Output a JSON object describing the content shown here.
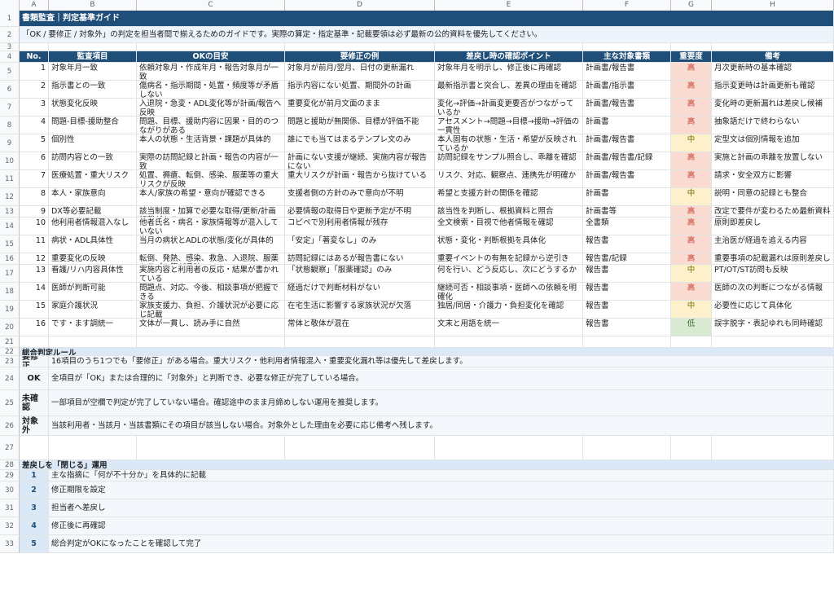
{
  "columns": [
    "A",
    "B",
    "C",
    "D",
    "E",
    "F",
    "G",
    "H"
  ],
  "title": "書類監査｜判定基準ガイド",
  "intro": "「OK / 要修正 / 対象外」の判定を担当者間で揃えるためのガイドです。実際の算定・指定基準・記載要領は必ず最新の公的資料を優先してください。",
  "headers": [
    "No.",
    "監査項目",
    "OKの目安",
    "要修正の例",
    "差戻し時の確認ポイント",
    "主な対象書類",
    "重要度",
    "備考"
  ],
  "items": [
    {
      "no": "1",
      "item": "対象年月一致",
      "ok": "依頼対象月・作成年月・報告対象月が一致",
      "fix": "対象月が前月/翌月、日付の更新漏れ",
      "check": "対象年月を明示し、修正後に再確認",
      "docs": "計画書/報告書",
      "pri": "高",
      "note": "月次更新時の基本確認"
    },
    {
      "no": "2",
      "item": "指示書との一致",
      "ok": "傷病名・指示期間・処置・頻度等が矛盾しない",
      "fix": "指示内容にない処置、期間外の計画",
      "check": "最新指示書と突合し、差異の理由を確認",
      "docs": "計画書/指示書",
      "pri": "高",
      "note": "指示変更時は計画更新も確認"
    },
    {
      "no": "3",
      "item": "状態変化反映",
      "ok": "入退院・急変・ADL変化等が計画/報告へ反映",
      "fix": "重要変化が前月文面のまま",
      "check": "変化→評価→計画変更要否がつながっているか",
      "docs": "計画書/報告書",
      "pri": "高",
      "note": "変化時の更新漏れは差戻し候補"
    },
    {
      "no": "4",
      "item": "問題-目標-援助整合",
      "ok": "問題、目標、援助内容に因果・目的のつながりがある",
      "fix": "問題と援助が無関係、目標が評価不能",
      "check": "アセスメント→問題→目標→援助→評価の一貫性",
      "docs": "計画書",
      "pri": "高",
      "note": "抽象語だけで終わらない"
    },
    {
      "no": "5",
      "item": "個別性",
      "ok": "本人の状態・生活背景・課題が具体的",
      "fix": "誰にでも当てはまるテンプレ文のみ",
      "check": "本人固有の状態・生活・希望が反映されているか",
      "docs": "計画書/報告書",
      "pri": "中",
      "note": "定型文は個別情報を追加"
    },
    {
      "no": "6",
      "item": "訪問内容との一致",
      "ok": "実際の訪問記録と計画・報告の内容が一致",
      "fix": "計画にない支援が継続、実施内容が報告にない",
      "check": "訪問記録をサンプル照合し、乖離を確認",
      "docs": "計画書/報告書/記録",
      "pri": "高",
      "note": "実施と計画の乖離を放置しない"
    },
    {
      "no": "7",
      "item": "医療処置・重大リスク",
      "ok": "処置、褥瘡、転倒、感染、服薬等の重大リスクが反映",
      "fix": "重大リスクが計画・報告から抜けている",
      "check": "リスク、対応、観察点、連携先が明確か",
      "docs": "計画書/報告書",
      "pri": "高",
      "note": "請求・安全双方に影響"
    },
    {
      "no": "8",
      "item": "本人・家族意向",
      "ok": "本人/家族の希望・意向が確認できる",
      "fix": "支援者側の方針のみで意向が不明",
      "check": "希望と支援方針の関係を確認",
      "docs": "計画書",
      "pri": "中",
      "note": "説明・同意の記録とも整合"
    },
    {
      "no": "9",
      "item": "DX等必要記載",
      "ok": "該当制度・加算で必要な取得/更新/計画記載がある",
      "fix": "必要情報の取得日や更新予定が不明",
      "check": "該当性を判断し、根拠資料と照合",
      "docs": "計画書等",
      "pri": "高",
      "note": "改定で要件が変わるため最新資料優先"
    },
    {
      "no": "10",
      "item": "他利用者情報混入なし",
      "ok": "他者氏名・病名・家族情報等が混入していない",
      "fix": "コピペで別利用者情報が残存",
      "check": "全文検索・目視で他者情報を確認",
      "docs": "全書類",
      "pri": "高",
      "note": "原則即差戻し"
    },
    {
      "no": "11",
      "item": "病状・ADL具体性",
      "ok": "当月の病状とADLの状態/変化が具体的",
      "fix": "「安定」「著変なし」のみ",
      "check": "状態・変化・判断根拠を具体化",
      "docs": "報告書",
      "pri": "高",
      "note": "主治医が経過を追える内容"
    },
    {
      "no": "12",
      "item": "重要変化の反映",
      "ok": "転倒、発熱、感染、救急、入退院、服薬トラブル等が反映",
      "fix": "訪問記録にはあるが報告書にない",
      "check": "重要イベントの有無を記録から逆引き",
      "docs": "報告書/記録",
      "pri": "高",
      "note": "重要事項の記載漏れは原則差戻し"
    },
    {
      "no": "13",
      "item": "看護/リハ内容具体性",
      "ok": "実施内容と利用者の反応・結果が書かれている",
      "fix": "「状態観察」「服薬確認」のみ",
      "check": "何を行い、どう反応し、次にどうするか",
      "docs": "報告書",
      "pri": "中",
      "note": "PT/OT/ST訪問も反映"
    },
    {
      "no": "14",
      "item": "医師が判断可能",
      "ok": "問題点、対応、今後、相談事項が把握できる",
      "fix": "経過だけで判断材料がない",
      "check": "継続可否・相談事項・医師への依頼を明確化",
      "docs": "報告書",
      "pri": "高",
      "note": "医師の次の判断につながる情報"
    },
    {
      "no": "15",
      "item": "家庭介護状況",
      "ok": "家族支援力、負担、介護状況が必要に応じ記載",
      "fix": "在宅生活に影響する家族状況が欠落",
      "check": "独居/同居・介護力・負担変化を確認",
      "docs": "報告書",
      "pri": "中",
      "note": "必要性に応じて具体化"
    },
    {
      "no": "16",
      "item": "です・ます調統一",
      "ok": "文体が一貫し、読み手に自然",
      "fix": "常体と敬体が混在",
      "check": "文末と用語を統一",
      "docs": "報告書",
      "pri": "低",
      "note": "誤字脱字・表記ゆれも同時確認"
    }
  ],
  "rules_title": "総合判定ルール",
  "rules": [
    {
      "key": "要修正",
      "text": "16項目のうち1つでも「要修正」がある場合。重大リスク・他利用者情報混入・重要変化漏れ等は優先して差戻します。"
    },
    {
      "key": "OK",
      "text": "全項目が「OK」または合理的に「対象外」と判断でき、必要な修正が完了している場合。"
    },
    {
      "key": "未確認",
      "text": "一部項目が空欄で判定が完了していない場合。確認途中のまま月締めしない運用を推奨します。"
    },
    {
      "key": "対象外",
      "text": "当該利用者・当該月・当該書類にその項目が該当しない場合。対象外とした理由を必要に応じ備考へ残します。"
    }
  ],
  "steps_title": "差戻しを「閉じる」運用",
  "steps": [
    {
      "n": "1",
      "text": "主な指摘に「何が不十分か」を具体的に記載"
    },
    {
      "n": "2",
      "text": "修正期限を設定"
    },
    {
      "n": "3",
      "text": "担当者へ差戻し"
    },
    {
      "n": "4",
      "text": "修正後に再確認"
    },
    {
      "n": "5",
      "text": "総合判定がOKになったことを確認して完了"
    }
  ],
  "row_numbers": [
    "1",
    "2",
    "3",
    "4",
    "5",
    "6",
    "7",
    "8",
    "9",
    "10",
    "11",
    "12",
    "13",
    "14",
    "15",
    "16",
    "17",
    "18",
    "19",
    "20",
    "21",
    "22",
    "23",
    "24",
    "25",
    "26",
    "27",
    "28",
    "29",
    "30",
    "31",
    "32",
    "33"
  ],
  "colors": {
    "header": "#1f4e79",
    "high": "#fadbd2",
    "mid": "#fdf1cc",
    "low": "#d9ead3",
    "section": "#dbe9f6"
  }
}
